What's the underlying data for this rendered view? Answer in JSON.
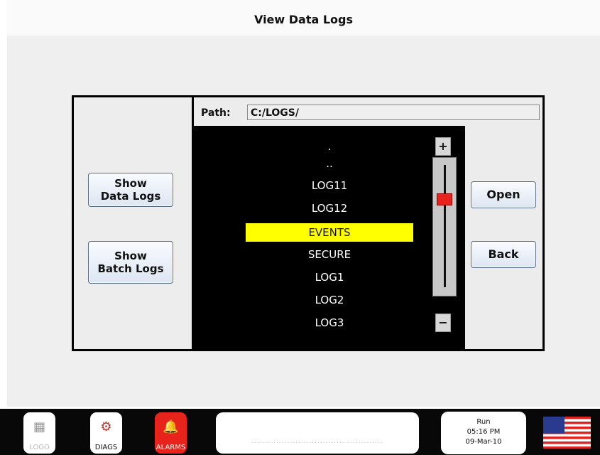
{
  "title": "View Data Logs",
  "left_buttons": {
    "show_data_logs": "Show\nData Logs",
    "show_batch_logs": "Show\nBatch Logs"
  },
  "path": {
    "label": "Path:",
    "value": "C:/LOGS/"
  },
  "file_list": {
    "items": [
      ".",
      "..",
      "LOG11",
      "LOG12",
      "EVENTS",
      "SECURE",
      "LOG1",
      "LOG2",
      "LOG3"
    ],
    "selected": "EVENTS"
  },
  "scroll": {
    "plus_label": "+",
    "minus_label": "−",
    "position": 0.25
  },
  "right_buttons": {
    "open": "Open",
    "back": "Back"
  },
  "taskbar": {
    "logo_label": "LOGO",
    "diags_label": "DIAGS",
    "alarms_label": "ALARMS",
    "message": "................................................",
    "status": {
      "mode": "Run",
      "time": "05:16 PM",
      "date": "09-Mar-10"
    }
  },
  "colors": {
    "selected_bg": "#ffff00",
    "alarm_red": "#e8231b",
    "list_bg": "#000000"
  }
}
